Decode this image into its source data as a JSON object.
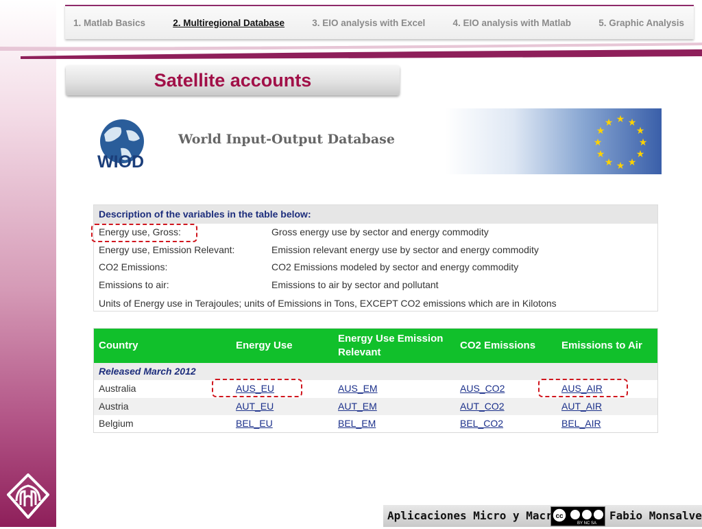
{
  "nav": {
    "tabs": [
      {
        "label": "1. Matlab Basics"
      },
      {
        "label": "2. Multiregional Database"
      },
      {
        "label": "3. EIO analysis with Excel"
      },
      {
        "label": "4. EIO analysis with Matlab"
      },
      {
        "label": "5. Graphic Analysis"
      }
    ],
    "active_index": 1
  },
  "title": "Satellite accounts",
  "banner": {
    "logo_text": "WIOD",
    "title": "World Input-Output Database"
  },
  "description": {
    "heading": "Description of the variables in the table below:",
    "rows": [
      {
        "key": "Energy use, Gross:",
        "value": "Gross energy use by sector and energy commodity"
      },
      {
        "key": "Energy use, Emission Relevant:",
        "value": "Emission relevant energy use by sector and energy commodity"
      },
      {
        "key": "CO2 Emissions:",
        "value": "CO2 Emissions modeled by sector and energy commodity"
      },
      {
        "key": "Emissions to air:",
        "value": "Emissions to air by sector and pollutant"
      }
    ],
    "note": "Units of Energy use in Terajoules; units of Emissions in Tons, EXCEPT CO2 emissions which are in Kilotons"
  },
  "table": {
    "headers": {
      "country": "Country",
      "energy_use": "Energy Use",
      "energy_use_em_1": "Energy Use Emission",
      "energy_use_em_2": "Relevant",
      "co2": "CO2 Emissions",
      "air": "Emissions to Air"
    },
    "release": "Released March 2012",
    "rows": [
      {
        "country": "Australia",
        "eu": "AUS_EU",
        "em": "AUS_EM",
        "co2": "AUS_CO2",
        "air": "AUS_AIR"
      },
      {
        "country": "Austria",
        "eu": "AUT_EU",
        "em": "AUT_EM",
        "co2": "AUT_CO2",
        "air": "AUT_AIR"
      },
      {
        "country": "Belgium",
        "eu": "BEL_EU",
        "em": "BEL_EM",
        "co2": "BEL_CO2",
        "air": "BEL_AIR"
      }
    ]
  },
  "footer": {
    "left": "Aplicaciones Micro y Macro",
    "license_badge": "BY NC SA",
    "right": "Fabio Monsalve"
  },
  "colors": {
    "title": "#a11048",
    "header_green": "#11c02b",
    "link": "#1a2f8a",
    "highlight": "#d0161e"
  }
}
